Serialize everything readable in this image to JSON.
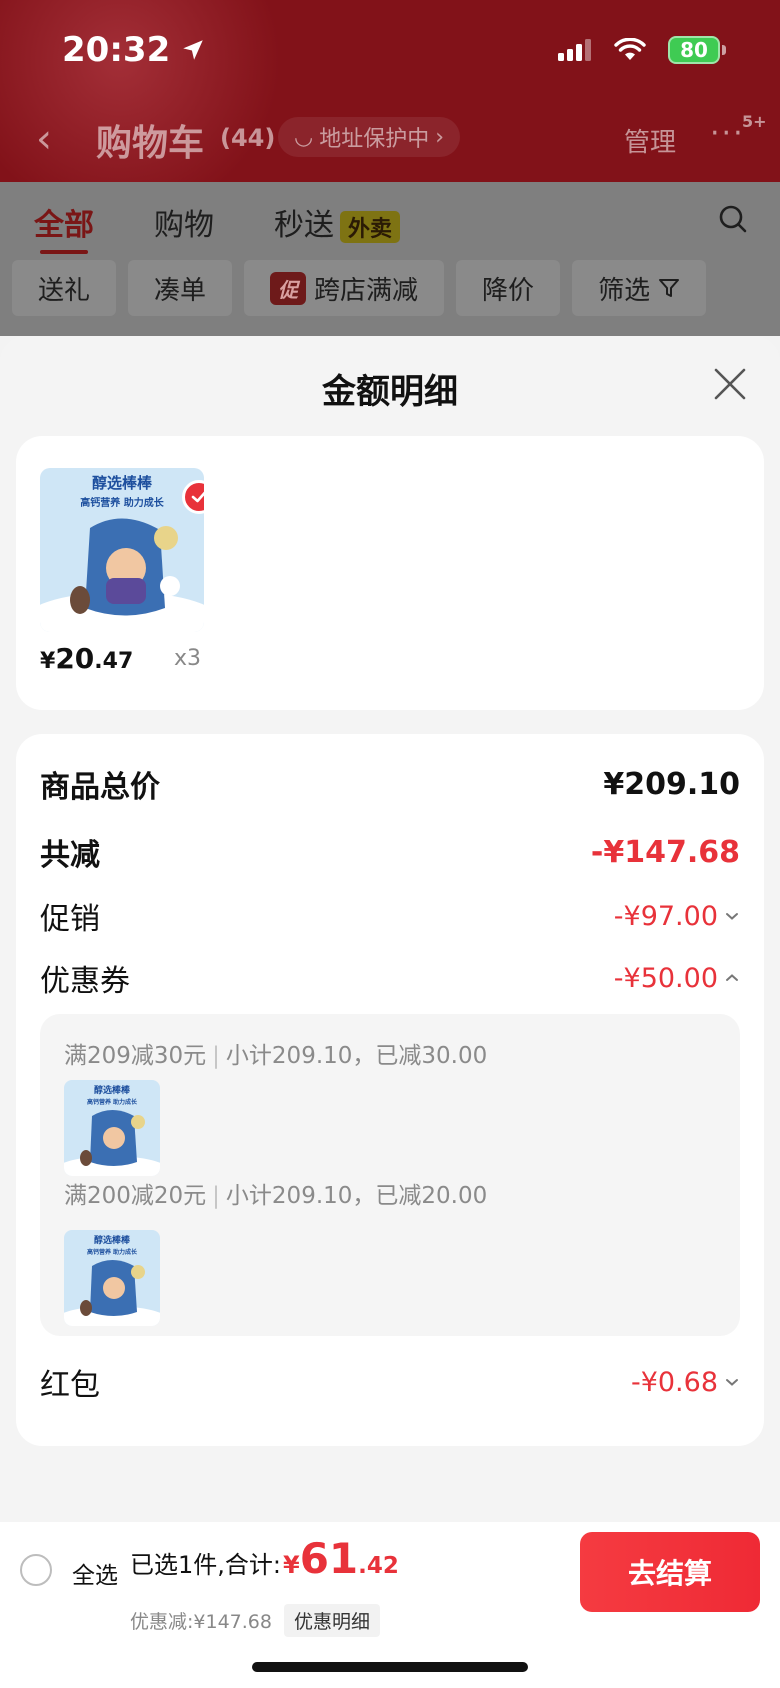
{
  "status_bar": {
    "time": "20:32",
    "battery": "80"
  },
  "nav": {
    "title": "购物车",
    "count": "(44)",
    "address_protect": "地址保护中",
    "manage": "管理",
    "more_badge": "5+"
  },
  "tabs": [
    {
      "label": "全部"
    },
    {
      "label": "购物"
    },
    {
      "label": "秒送",
      "badge": "外卖"
    }
  ],
  "filter_chips": [
    {
      "label": "送礼"
    },
    {
      "label": "凑单"
    },
    {
      "label": "跨店满减",
      "tag": "促"
    },
    {
      "label": "降价"
    },
    {
      "label": "筛选"
    }
  ],
  "sheet": {
    "title": "金额明细",
    "product": {
      "price_symbol": "¥",
      "price_int": "20",
      "price_dec": ".47",
      "quantity": "x3",
      "thumb_brand": "醇选棒棒",
      "thumb_slogan": "高钙营养 助力成长"
    },
    "rows": {
      "goods_total_label": "商品总价",
      "goods_total_value": "¥209.10",
      "total_reduce_label": "共减",
      "total_reduce_value": "-¥147.68",
      "promotion_label": "促销",
      "promotion_value": "-¥97.00",
      "coupon_label": "优惠券",
      "coupon_value": "-¥50.00",
      "red_packet_label": "红包",
      "red_packet_value": "-¥0.68"
    },
    "coupons": [
      {
        "rule": "满209减30元",
        "detail": "小计209.10，已减30.00"
      },
      {
        "rule": "满200减20元",
        "detail": "小计209.10，已减20.00"
      }
    ]
  },
  "bottom_bar": {
    "select_all": "全选",
    "selected_summary": "已选1件,合计:",
    "total_symbol": "¥",
    "total_int": "61",
    "total_dec": ".42",
    "discount": "优惠减:¥147.68",
    "discount_detail": "优惠明细",
    "checkout": "去结算"
  },
  "colors": {
    "accent_red": "#e8323a",
    "header_bg": "#821219"
  }
}
